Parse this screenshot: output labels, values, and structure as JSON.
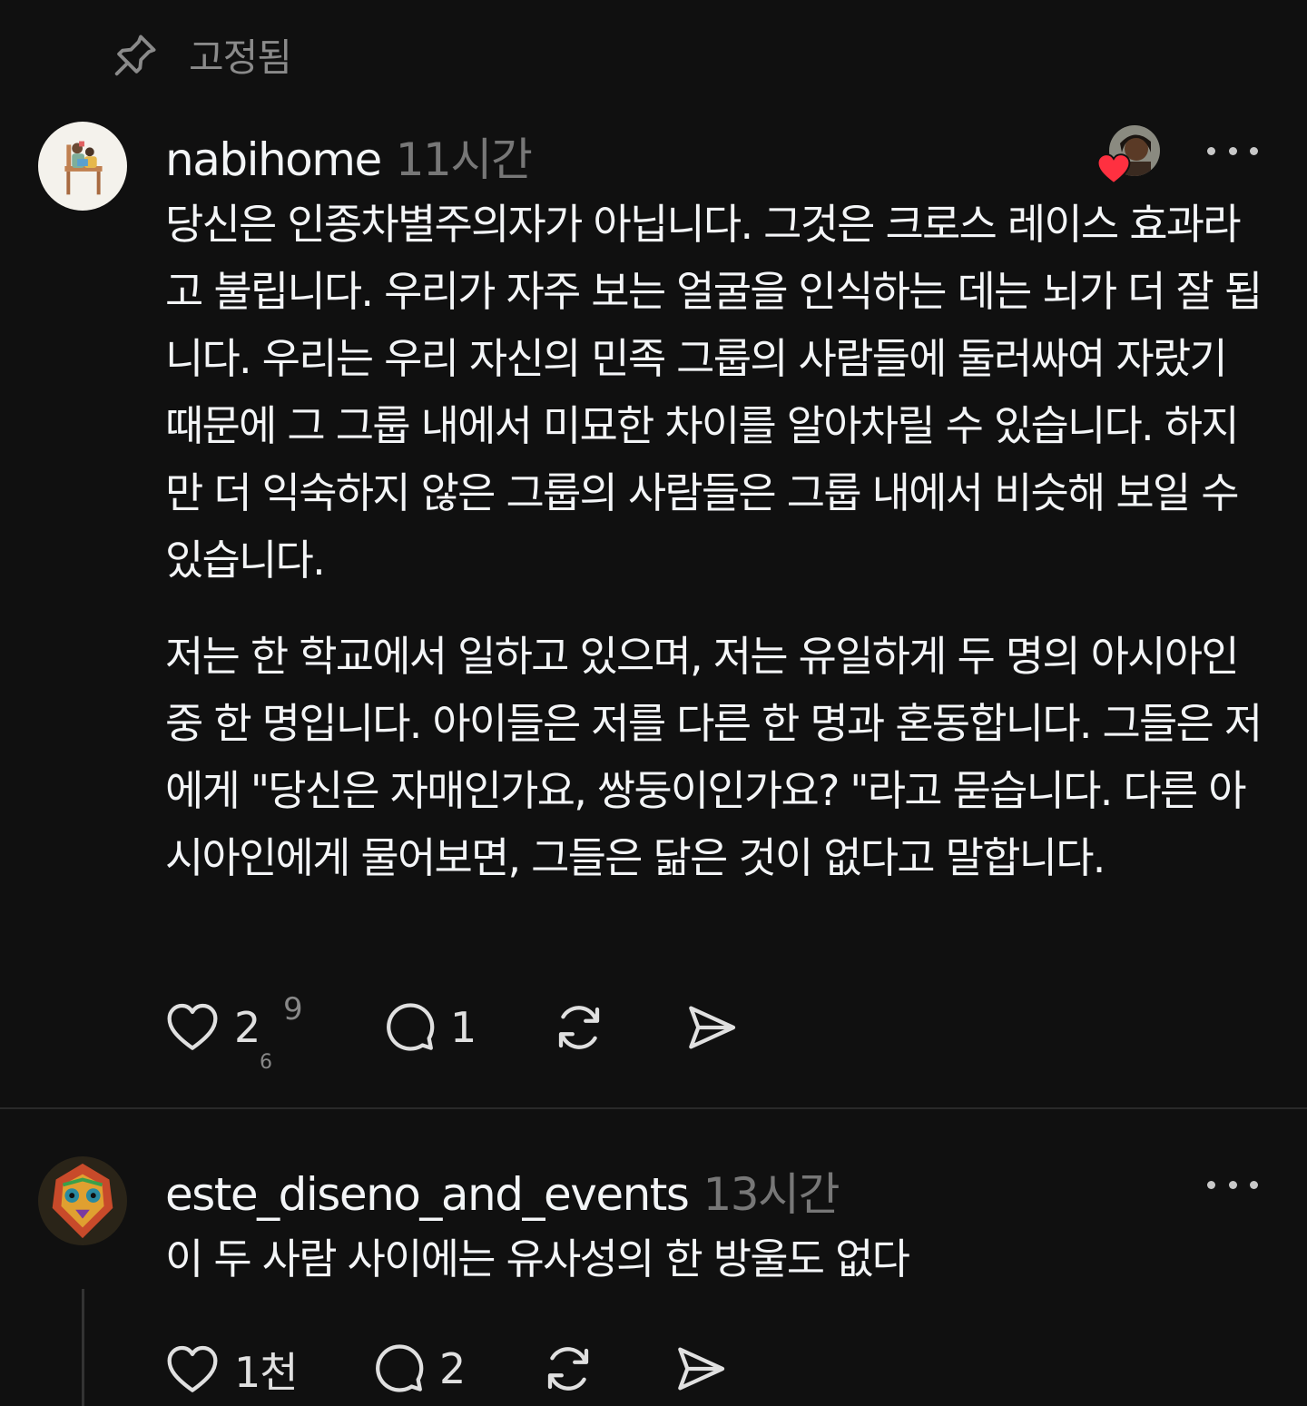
{
  "pinned": {
    "label": "고정됨",
    "icon": "pin-icon"
  },
  "comments": [
    {
      "username": "nabihome",
      "time": "11시간",
      "paragraphs": [
        "당신은 인종차별주의자가 아닙니다. 그것은 크로스 레이스 효과라고 불립니다. 우리가 자주 보는 얼굴을 인식하는 데는 뇌가 더 잘 됩니다. 우리는 우리 자신의 민족 그룹의 사람들에 둘러싸여 자랐기 때문에 그 그룹 내에서 미묘한 차이를 알아차릴 수 있습니다. 하지만 더 익숙하지 않은 그룹의 사람들은 그룹 내에서 비슷해 보일 수 있습니다.",
        "저는 한 학교에서 일하고 있으며, 저는 유일하게 두 명의 아시아인 중 한 명입니다. 아이들은 저를 다른 한 명과 혼동합니다. 그들은 저에게 \"당신은 자매인가요, 쌍둥이인가요? \"라고 묻습니다. 다른 아시아인에게 물어보면, 그들은 닮은 것이 없다고 말합니다."
      ],
      "likes": "2",
      "replies": "1",
      "scribbles": [
        "9",
        "6"
      ]
    },
    {
      "username": "este_diseno_and_events",
      "time": "13시간",
      "paragraphs": [
        "이 두 사람 사이에는 유사성의 한 방울도 없다"
      ],
      "likes": "1천",
      "replies": "2"
    }
  ],
  "colors": {
    "background": "#101010",
    "text": "#f3f5f7",
    "muted": "#777777",
    "heart": "#ff3040"
  }
}
